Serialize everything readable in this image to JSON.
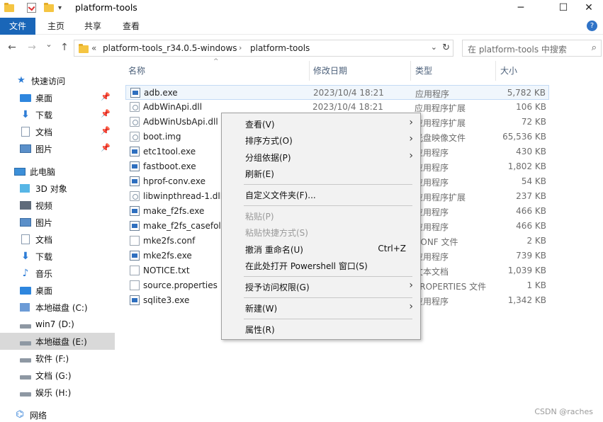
{
  "window": {
    "title": "platform-tools",
    "min_glyph": "─",
    "max_glyph": "☐",
    "close_glyph": "✕"
  },
  "quick_access_toolbar": {
    "dropdown_glyph": "▾"
  },
  "ribbon": {
    "tabs": [
      "文件",
      "主页",
      "共享",
      "查看"
    ],
    "help_glyph": "?"
  },
  "nav": {
    "back_glyph": "←",
    "forward_glyph": "→",
    "history_glyph": "⌄",
    "up_glyph": "↑"
  },
  "address": {
    "overflow": "«",
    "crumbs": [
      "platform-tools_r34.0.5-windows",
      "platform-tools"
    ],
    "sep_glyph": "›",
    "dropdown_glyph": "⌄",
    "refresh_glyph": "↻"
  },
  "search": {
    "placeholder": "在 platform-tools 中搜索",
    "icon_glyph": "⌕"
  },
  "sidebar": {
    "pin_glyph": "📌",
    "quick_access": {
      "label": "快速访问",
      "items": [
        {
          "label": "桌面",
          "icon": "desktop-icon",
          "pinned": true
        },
        {
          "label": "下载",
          "icon": "download-icon",
          "pinned": true
        },
        {
          "label": "文档",
          "icon": "document-icon",
          "pinned": true
        },
        {
          "label": "图片",
          "icon": "pictures-icon",
          "pinned": true
        }
      ]
    },
    "this_pc": {
      "label": "此电脑",
      "items": [
        {
          "label": "3D 对象",
          "icon": "3d-objects-icon"
        },
        {
          "label": "视频",
          "icon": "video-icon"
        },
        {
          "label": "图片",
          "icon": "pictures-icon"
        },
        {
          "label": "文档",
          "icon": "document-icon"
        },
        {
          "label": "下载",
          "icon": "download-icon"
        },
        {
          "label": "音乐",
          "icon": "music-icon"
        },
        {
          "label": "桌面",
          "icon": "desktop-icon"
        },
        {
          "label": "本地磁盘 (C:)",
          "icon": "system-drive-icon"
        },
        {
          "label": "win7 (D:)",
          "icon": "drive-icon"
        },
        {
          "label": "本地磁盘 (E:)",
          "icon": "drive-icon",
          "selected": true
        },
        {
          "label": "软件 (F:)",
          "icon": "drive-icon"
        },
        {
          "label": "文档 (G:)",
          "icon": "drive-icon"
        },
        {
          "label": "娱乐 (H:)",
          "icon": "drive-icon"
        }
      ]
    },
    "network": {
      "label": "网络",
      "icon": "network-icon"
    },
    "glyphs": {
      "star": "★",
      "down": "⬇",
      "music": "♪",
      "net": "⌬"
    }
  },
  "columns": {
    "name": "名称",
    "date": "修改日期",
    "type": "类型",
    "size": "大小",
    "sort_glyph": "^"
  },
  "files": [
    {
      "name": "adb.exe",
      "date": "2023/10/4 18:21",
      "type": "应用程序",
      "size": "5,782 KB",
      "icon": "exe"
    },
    {
      "name": "AdbWinApi.dll",
      "date": "2023/10/4 18:21",
      "type": "应用程序扩展",
      "size": "106 KB",
      "icon": "dll"
    },
    {
      "name": "AdbWinUsbApi.dll",
      "date": "",
      "type": "应用程序扩展",
      "size": "72 KB",
      "icon": "dll"
    },
    {
      "name": "boot.img",
      "date": "",
      "type": "光盘映像文件",
      "size": "65,536 KB",
      "icon": "dll"
    },
    {
      "name": "etc1tool.exe",
      "date": "",
      "type": "应用程序",
      "size": "430 KB",
      "icon": "exe"
    },
    {
      "name": "fastboot.exe",
      "date": "",
      "type": "应用程序",
      "size": "1,802 KB",
      "icon": "exe"
    },
    {
      "name": "hprof-conv.exe",
      "date": "",
      "type": "应用程序",
      "size": "54 KB",
      "icon": "exe"
    },
    {
      "name": "libwinpthread-1.dll",
      "date": "",
      "type": "应用程序扩展",
      "size": "237 KB",
      "icon": "dll"
    },
    {
      "name": "make_f2fs.exe",
      "date": "",
      "type": "应用程序",
      "size": "466 KB",
      "icon": "exe"
    },
    {
      "name": "make_f2fs_casefold.exe",
      "date": "",
      "type": "应用程序",
      "size": "466 KB",
      "icon": "exe"
    },
    {
      "name": "mke2fs.conf",
      "date": "",
      "type": "CONF 文件",
      "size": "2 KB",
      "icon": "txt"
    },
    {
      "name": "mke2fs.exe",
      "date": "",
      "type": "应用程序",
      "size": "739 KB",
      "icon": "exe"
    },
    {
      "name": "NOTICE.txt",
      "date": "",
      "type": "文本文档",
      "size": "1,039 KB",
      "icon": "txt"
    },
    {
      "name": "source.properties",
      "date": "",
      "type": "PROPERTIES 文件",
      "size": "1 KB",
      "icon": "txt"
    },
    {
      "name": "sqlite3.exe",
      "date": "",
      "type": "应用程序",
      "size": "1,342 KB",
      "icon": "exe"
    }
  ],
  "context_menu": {
    "arrow_glyph": "›",
    "items": [
      {
        "label": "查看(V)",
        "submenu": true
      },
      {
        "label": "排序方式(O)",
        "submenu": true
      },
      {
        "label": "分组依据(P)",
        "submenu": true
      },
      {
        "label": "刷新(E)"
      },
      {
        "sep": true
      },
      {
        "label": "自定义文件夹(F)..."
      },
      {
        "sep": true
      },
      {
        "label": "粘贴(P)",
        "disabled": true
      },
      {
        "label": "粘贴快捷方式(S)",
        "disabled": true
      },
      {
        "label": "撤消 重命名(U)",
        "shortcut": "Ctrl+Z"
      },
      {
        "label": "在此处打开 Powershell 窗口(S)",
        "highlight": true
      },
      {
        "sep": true
      },
      {
        "label": "授予访问权限(G)",
        "submenu": true
      },
      {
        "sep": true
      },
      {
        "label": "新建(W)",
        "submenu": true
      },
      {
        "sep": true
      },
      {
        "label": "属性(R)"
      }
    ]
  },
  "watermark": "CSDN @raches",
  "colors": {
    "ribbon_file_tab": "#1a66b8",
    "highlight": "#ffe600",
    "menu_bg": "#f2f2f2",
    "selected_nav": "#d9d9d9"
  }
}
